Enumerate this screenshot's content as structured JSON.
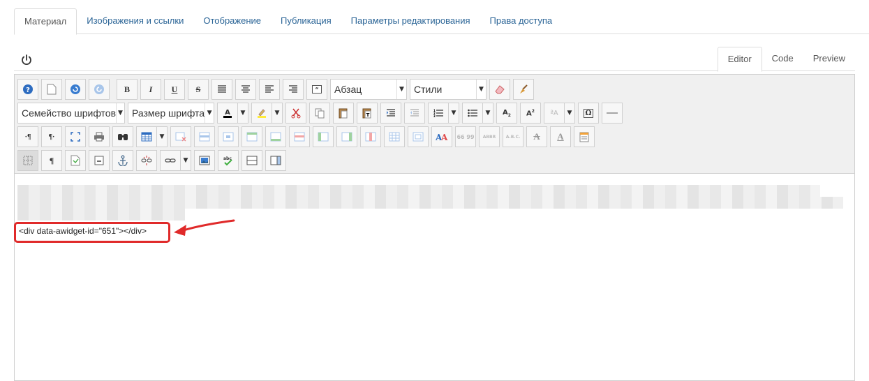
{
  "top_tabs": [
    {
      "label": "Материал",
      "active": true
    },
    {
      "label": "Изображения и ссылки",
      "active": false
    },
    {
      "label": "Отображение",
      "active": false
    },
    {
      "label": "Публикация",
      "active": false
    },
    {
      "label": "Параметры редактирования",
      "active": false
    },
    {
      "label": "Права доступа",
      "active": false
    }
  ],
  "mode_tabs": [
    {
      "label": "Editor",
      "active": true
    },
    {
      "label": "Code",
      "active": false
    },
    {
      "label": "Preview",
      "active": false
    }
  ],
  "toolbar": {
    "format_select": "Абзац",
    "styles_select": "Стили",
    "font_family_select": "Семейство шрифтов",
    "font_size_select": "Размер шрифта"
  },
  "content": {
    "code_line": "<div data-awidget-id=\"651\"></div>"
  },
  "colors": {
    "link": "#2a6496",
    "annotation_red": "#e02a2a",
    "toolbar_bg": "#f0f0f0"
  }
}
